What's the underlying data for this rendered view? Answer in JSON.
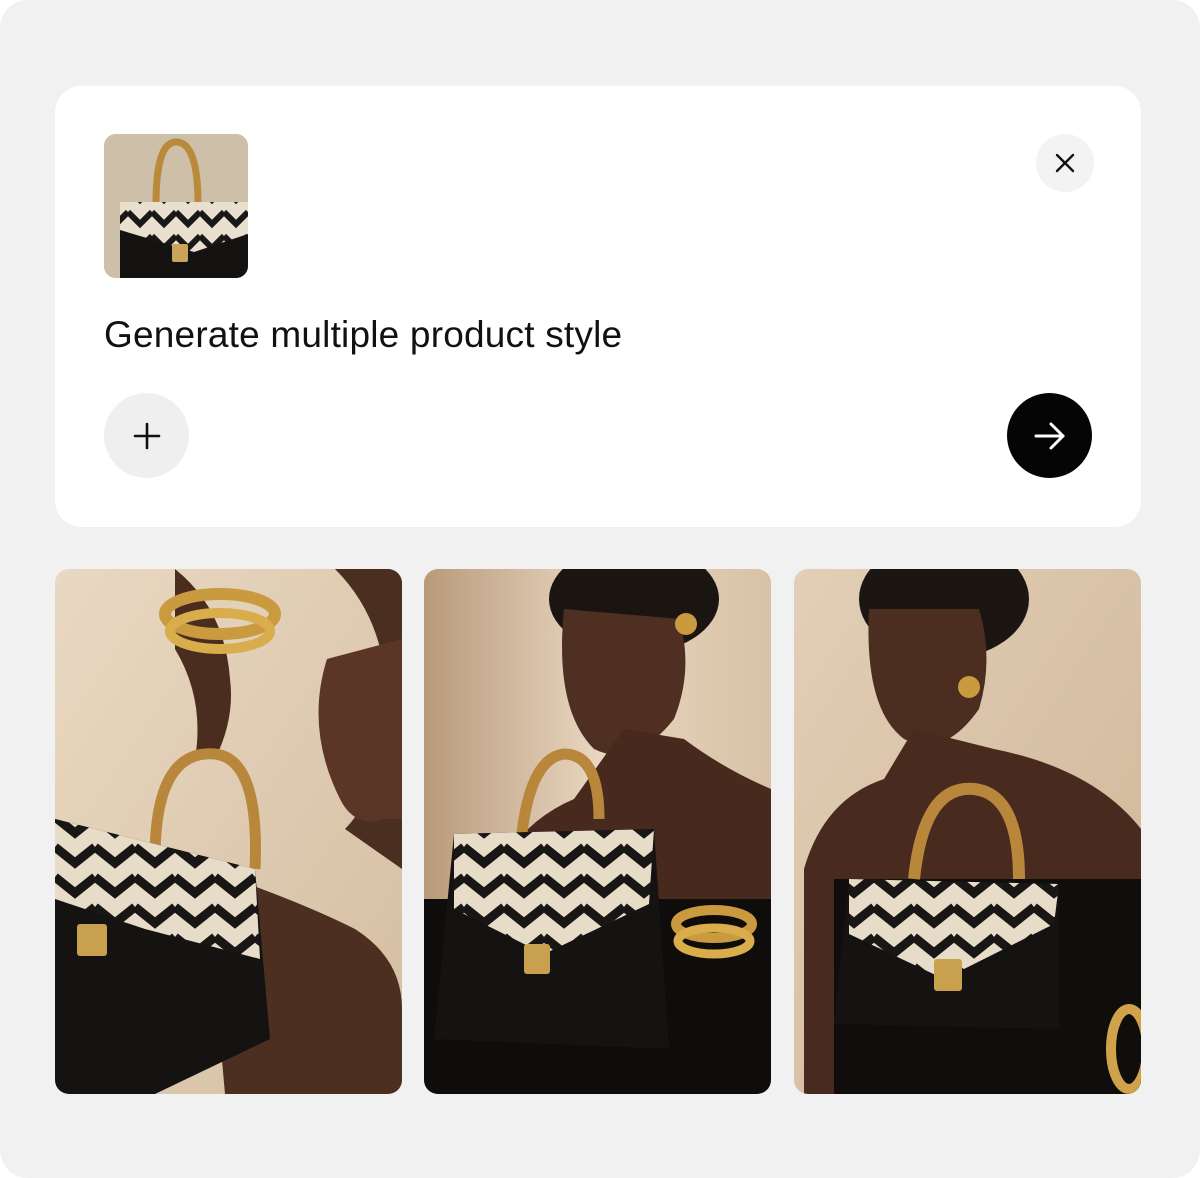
{
  "prompt": {
    "text": "Generate multiple product style"
  },
  "attachment": {
    "icon": "product-thumbnail-handbag"
  },
  "buttons": {
    "close_icon": "close-icon",
    "add_icon": "plus-icon",
    "send_icon": "arrow-right-icon"
  },
  "gallery": {
    "images": [
      {
        "icon": "generated-image-model-holding-bag-profile"
      },
      {
        "icon": "generated-image-model-seated-holding-bag"
      },
      {
        "icon": "generated-image-model-holding-bag-front"
      }
    ]
  },
  "colors": {
    "background": "#f1f1f1",
    "card": "#ffffff",
    "send_button": "#050505",
    "secondary_button": "#efefef"
  }
}
